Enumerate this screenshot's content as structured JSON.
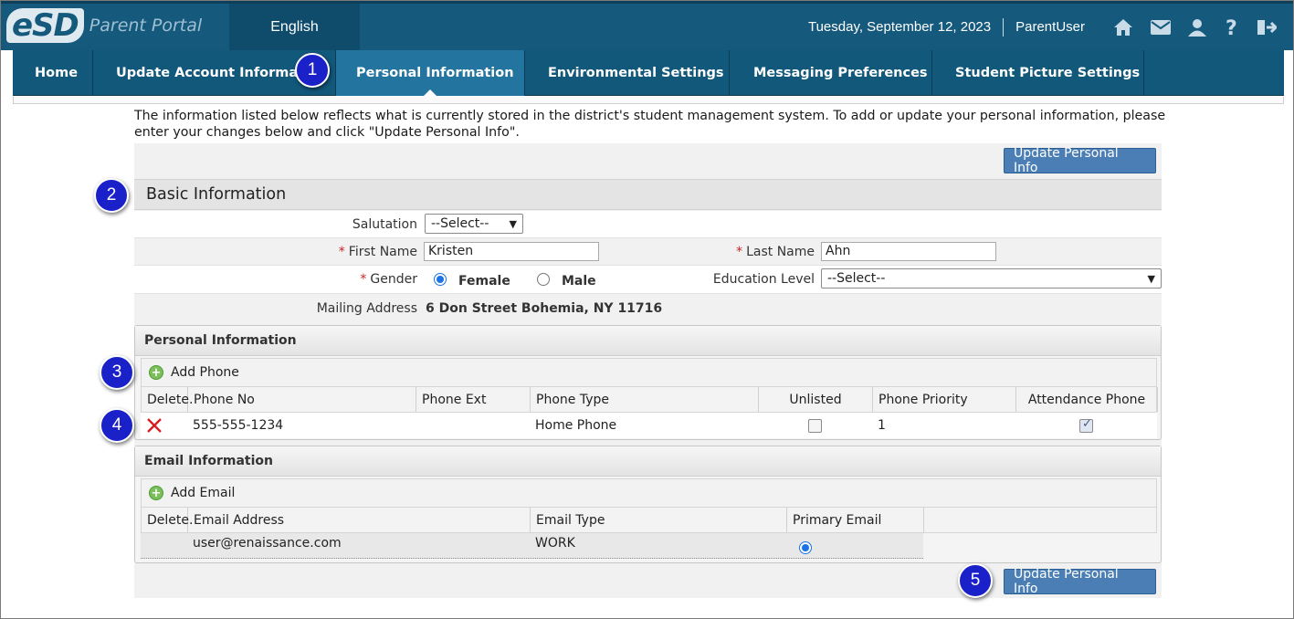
{
  "header": {
    "logo_mark": "eSD",
    "logo_text": "Parent Portal",
    "language": "English",
    "date": "Tuesday, September 12, 2023",
    "user": "ParentUser",
    "icons": [
      "home-icon",
      "mail-icon",
      "user-icon",
      "help-icon",
      "logout-icon"
    ],
    "bar_color": "#15597c"
  },
  "nav": {
    "items": [
      {
        "label": "Home"
      },
      {
        "label": "Update Account Informat"
      },
      {
        "label": "Personal Information",
        "active": true
      },
      {
        "label": "Environmental Settings"
      },
      {
        "label": "Messaging Preferences"
      },
      {
        "label": "Student Picture Settings"
      }
    ]
  },
  "intro": "The information listed below reflects what is currently stored in the district's student management system. To add or update your personal information, please enter your changes below and click \"Update Personal Info\".",
  "buttons": {
    "update": "Update Personal Info"
  },
  "basic": {
    "title": "Basic Information",
    "salutation_label": "Salutation",
    "salutation_value": "--Select--",
    "first_name_label": "First Name",
    "first_name_value": "Kristen",
    "last_name_label": "Last Name",
    "last_name_value": "Ahn",
    "gender_label": "Gender",
    "gender_female": "Female",
    "gender_male": "Male",
    "gender_selected": "Female",
    "education_label": "Education Level",
    "education_value": "--Select--",
    "mailing_label": "Mailing Address",
    "mailing_value": "6 Don Street Bohemia, NY 11716",
    "required_mark": "*"
  },
  "personal": {
    "title": "Personal Information",
    "add_label": "Add Phone",
    "columns": [
      "Delete.",
      "Phone No",
      "Phone Ext",
      "Phone Type",
      "Unlisted",
      "Phone Priority",
      "Attendance Phone"
    ],
    "rows": [
      {
        "phone": "555-555-1234",
        "ext": "",
        "type": "Home Phone",
        "unlisted": false,
        "priority": "1",
        "attendance": true
      }
    ]
  },
  "email": {
    "title": "Email Information",
    "add_label": "Add Email",
    "columns": [
      "Delete.",
      "Email Address",
      "Email Type",
      "Primary Email"
    ],
    "rows": [
      {
        "address": "user@renaissance.com",
        "type": "WORK",
        "primary": true
      }
    ]
  },
  "callouts": [
    "1",
    "2",
    "3",
    "4",
    "5"
  ]
}
